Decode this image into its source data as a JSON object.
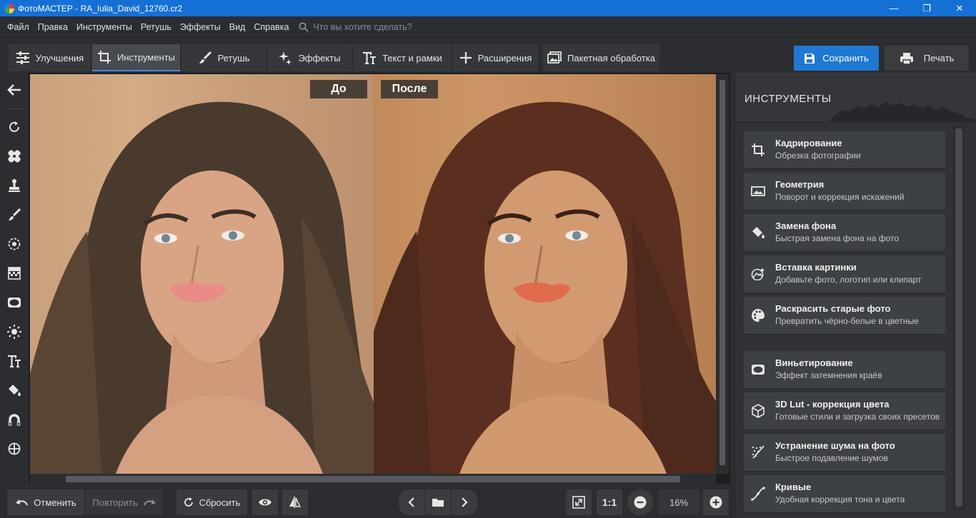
{
  "window": {
    "title": "ФотоМАСТЕР - RA_Iulia_David_12760.cr2",
    "minimize": "—",
    "maximize": "❐",
    "close": "✕"
  },
  "menu": {
    "items": [
      "Файл",
      "Правка",
      "Инструменты",
      "Ретушь",
      "Эффекты",
      "Вид",
      "Справка"
    ],
    "search_placeholder": "Что вы хотите сделать?"
  },
  "tabs": [
    {
      "label": "Улучшения",
      "icon": "sliders-icon"
    },
    {
      "label": "Инструменты",
      "icon": "crop-icon",
      "active": true
    },
    {
      "label": "Ретушь",
      "icon": "brush-icon"
    },
    {
      "label": "Эффекты",
      "icon": "sparkle-icon"
    },
    {
      "label": "Текст и рамки",
      "icon": "text-icon"
    },
    {
      "label": "Расширения",
      "icon": "plus-icon"
    }
  ],
  "batch_label": "Пакетная обработка",
  "save_label": "Сохранить",
  "print_label": "Печать",
  "compare": {
    "before": "До",
    "after": "После"
  },
  "panel": {
    "title": "ИНСТРУМЕНТЫ",
    "items": [
      {
        "title": "Кадрирование",
        "desc": "Обрезка фотографии",
        "icon": "crop-icon"
      },
      {
        "title": "Геометрия",
        "desc": "Поворот и коррекция искажений",
        "icon": "geometry-icon"
      },
      {
        "title": "Замена фона",
        "desc": "Быстрая замена фона на фото",
        "icon": "paint-bucket-icon"
      },
      {
        "title": "Вставка картинки",
        "desc": "Добавьте фото, логотип или клипарт",
        "icon": "insert-image-icon"
      },
      {
        "title": "Раскрасить старые фото",
        "desc": "Превратить чёрно-белые в цветные",
        "icon": "palette-icon"
      },
      {
        "title": "Виньетирование",
        "desc": "Эффект затемнения краёв",
        "icon": "vignette-icon"
      },
      {
        "title": "3D Lut - коррекция цвета",
        "desc": "Готовые стили и загрузка своих пресетов",
        "icon": "cube-icon"
      },
      {
        "title": "Устранение шума на фото",
        "desc": "Быстрое подавление шумов",
        "icon": "noise-icon"
      },
      {
        "title": "Кривые",
        "desc": "Удобная коррекция тона и цвета",
        "icon": "curves-icon"
      }
    ]
  },
  "bottom": {
    "undo": "Отменить",
    "redo": "Повторить",
    "reset": "Сбросить",
    "ratio": "1:1",
    "zoom": "16%"
  }
}
